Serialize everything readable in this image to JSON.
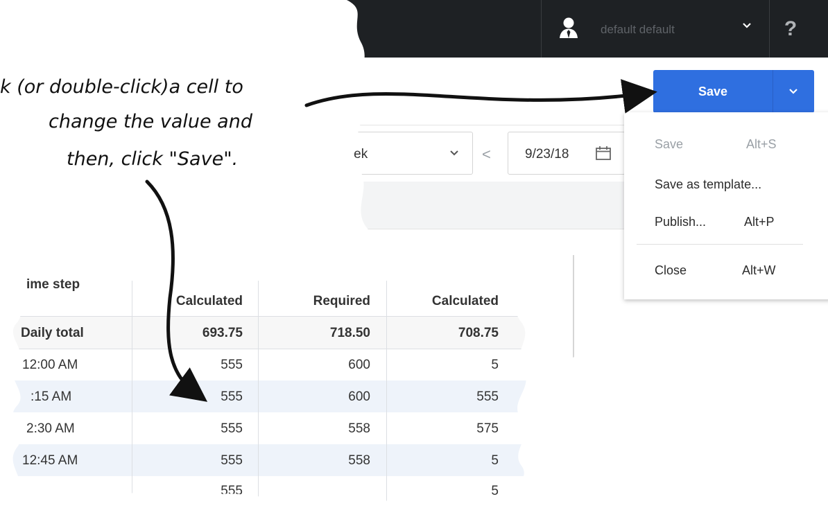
{
  "header": {
    "user_name": "default default",
    "help_label": "?"
  },
  "toolbar": {
    "period_value": "Week",
    "prev_label": "<",
    "date_value": "9/23/18"
  },
  "save_button": {
    "label": "Save",
    "accent": "#2f6fe0"
  },
  "save_menu": [
    {
      "label": "Save",
      "shortcut": "Alt+S",
      "disabled": true
    },
    {
      "label": "Save as template...",
      "shortcut": "",
      "disabled": false
    },
    {
      "label": "Publish...",
      "shortcut": "Alt+P",
      "disabled": false
    },
    {
      "label": "Close",
      "shortcut": "Alt+W",
      "disabled": false
    }
  ],
  "table": {
    "headers": [
      "ime step",
      "Calculated",
      "Required",
      "Calculated"
    ],
    "total_row": [
      "Daily total",
      "693.75",
      "718.50",
      "708.75"
    ],
    "rows": [
      [
        "12:00 AM",
        "555",
        "600",
        "5"
      ],
      [
        ":15 AM",
        "555",
        "600",
        "555"
      ],
      [
        "2:30 AM",
        "555",
        "558",
        "575"
      ],
      [
        "12:45 AM",
        "555",
        "558",
        "5"
      ],
      [
        "",
        "555",
        "",
        "5"
      ]
    ]
  },
  "annotation": {
    "line1": "k (or double-click)a cell to",
    "line2": "change the value and",
    "line3": "then, click \"Save\"."
  }
}
